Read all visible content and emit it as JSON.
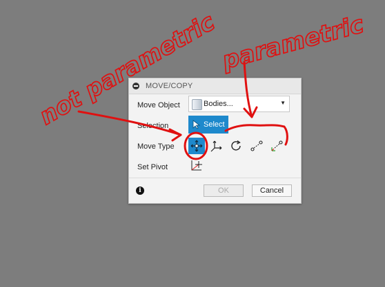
{
  "dialog": {
    "title": "MOVE/COPY",
    "rows": {
      "move_object_label": "Move Object",
      "selection_label": "Selection",
      "move_type_label": "Move Type",
      "set_pivot_label": "Set Pivot"
    },
    "move_object_value": "Bodies...",
    "select_button_label": "Select",
    "move_types": [
      "free-move-icon",
      "translate-icon",
      "rotate-icon",
      "point-to-point-icon",
      "point-to-position-icon"
    ],
    "selected_move_type": "free-move-icon",
    "footer": {
      "ok_label": "OK",
      "cancel_label": "Cancel"
    }
  },
  "annotations": {
    "left_note": "not parametric",
    "right_note": "parametric",
    "color": "#e01010"
  },
  "colors": {
    "accent": "#1e89cc",
    "background": "#7d7d7d"
  }
}
